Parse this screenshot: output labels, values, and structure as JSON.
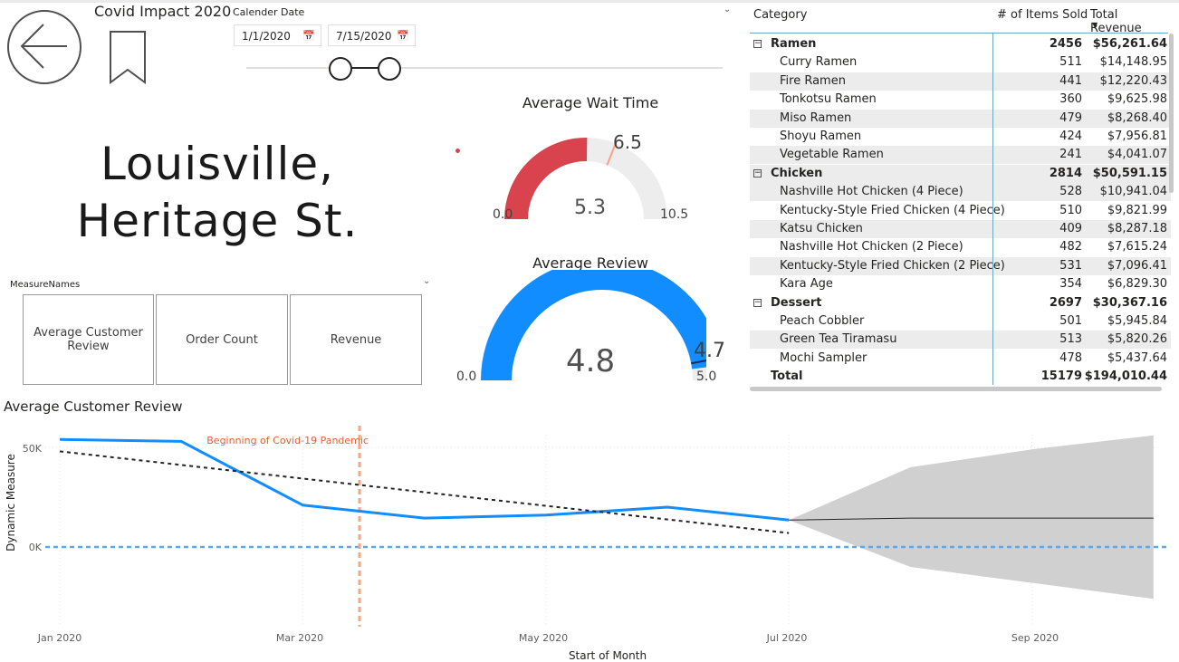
{
  "header": {
    "report_title": "Covid Impact 2020",
    "back_icon": "arrow-left-icon",
    "bookmark_icon": "bookmark-icon"
  },
  "date_slicer": {
    "title": "Calender Date",
    "start": "1/1/2020",
    "end": "7/15/2020",
    "calendar_icon": "calendar-icon"
  },
  "location": {
    "line1": "Louisville,",
    "line2": "Heritage St."
  },
  "measure_slicer": {
    "title": "MeasureNames",
    "options": [
      "Average Customer Review",
      "Order Count",
      "Revenue"
    ]
  },
  "gauges": [
    {
      "title": "Average Wait Time",
      "value_label": "5.3",
      "min_label": "0.0",
      "max_label": "10.5",
      "target_label": "6.5",
      "value": 5.3,
      "min": 0,
      "max": 10.5,
      "target": 6.5,
      "fill_color": "#d9434e"
    },
    {
      "title": "Average Review",
      "value_label": "4.8",
      "min_label": "0.0",
      "max_label": "5.0",
      "target_label": "4.7",
      "value": 4.8,
      "min": 0,
      "max": 5.0,
      "target": 4.7,
      "fill_color": "#118dff"
    }
  ],
  "table": {
    "columns": [
      "Category",
      "# of Items Sold",
      "Total Revenue"
    ],
    "rows": [
      {
        "type": "group",
        "name": "Ramen",
        "items": "2456",
        "rev": "$56,261.64"
      },
      {
        "type": "item",
        "name": "Curry Ramen",
        "items": "511",
        "rev": "$14,148.95"
      },
      {
        "type": "item",
        "name": "Fire Ramen",
        "items": "441",
        "rev": "$12,220.43"
      },
      {
        "type": "item",
        "name": "Tonkotsu Ramen",
        "items": "360",
        "rev": "$9,625.98"
      },
      {
        "type": "item",
        "name": "Miso Ramen",
        "items": "479",
        "rev": "$8,268.40"
      },
      {
        "type": "item",
        "name": "Shoyu Ramen",
        "items": "424",
        "rev": "$7,956.81"
      },
      {
        "type": "item",
        "name": "Vegetable Ramen",
        "items": "241",
        "rev": "$4,041.07"
      },
      {
        "type": "group",
        "name": "Chicken",
        "items": "2814",
        "rev": "$50,591.15"
      },
      {
        "type": "item",
        "name": "Nashville Hot Chicken (4 Piece)",
        "items": "528",
        "rev": "$10,941.04"
      },
      {
        "type": "item",
        "name": "Kentucky-Style Fried Chicken (4 Piece)",
        "items": "510",
        "rev": "$9,821.99"
      },
      {
        "type": "item",
        "name": "Katsu Chicken",
        "items": "409",
        "rev": "$8,287.18"
      },
      {
        "type": "item",
        "name": "Nashville Hot Chicken (2 Piece)",
        "items": "482",
        "rev": "$7,615.24"
      },
      {
        "type": "item",
        "name": "Kentucky-Style Fried Chicken (2 Piece)",
        "items": "531",
        "rev": "$7,096.41"
      },
      {
        "type": "item",
        "name": "Kara Age",
        "items": "354",
        "rev": "$6,829.30"
      },
      {
        "type": "group",
        "name": "Dessert",
        "items": "2697",
        "rev": "$30,367.16"
      },
      {
        "type": "item",
        "name": "Peach Cobbler",
        "items": "501",
        "rev": "$5,945.84"
      },
      {
        "type": "item",
        "name": "Green Tea Tiramasu",
        "items": "513",
        "rev": "$5,820.26"
      },
      {
        "type": "item",
        "name": "Mochi Sampler",
        "items": "478",
        "rev": "$5,437.64"
      },
      {
        "type": "total",
        "name": "Total",
        "items": "15179",
        "rev": "$194,010.44"
      }
    ]
  },
  "chart_data": {
    "type": "line",
    "title": "Average Customer Review",
    "xlabel": "Start of Month",
    "ylabel": "Dynamic Measure",
    "x_ticks": [
      "Jan 2020",
      "Mar 2020",
      "May 2020",
      "Jul 2020",
      "Sep 2020"
    ],
    "y_ticks": [
      "50K",
      "0K"
    ],
    "ylim": [
      -30000,
      58000
    ],
    "series": [
      {
        "kind": "actual",
        "color": "#118dff",
        "x": [
          "2020-01",
          "2020-02",
          "2020-03",
          "2020-04",
          "2020-05",
          "2020-06",
          "2020-07"
        ],
        "y": [
          54000,
          53000,
          21000,
          14500,
          16000,
          20000,
          13500
        ]
      },
      {
        "kind": "trend",
        "color": "#252423",
        "x": [
          "2020-01",
          "2020-07"
        ],
        "y": [
          48000,
          7000
        ]
      },
      {
        "kind": "forecast",
        "color": "#252423",
        "x": [
          "2020-07",
          "2020-08",
          "2020-09",
          "2020-10"
        ],
        "y": [
          13500,
          14500,
          14500,
          14500
        ],
        "upper": [
          13500,
          40000,
          49000,
          56000
        ],
        "lower": [
          13500,
          -10000,
          -18000,
          -26000
        ]
      }
    ],
    "annotation": {
      "label": "Beginning of Covid-19 Pandemic",
      "x": "2020-03-15",
      "color": "#f4a582"
    },
    "zero_line_color": "#5aa9ef"
  }
}
